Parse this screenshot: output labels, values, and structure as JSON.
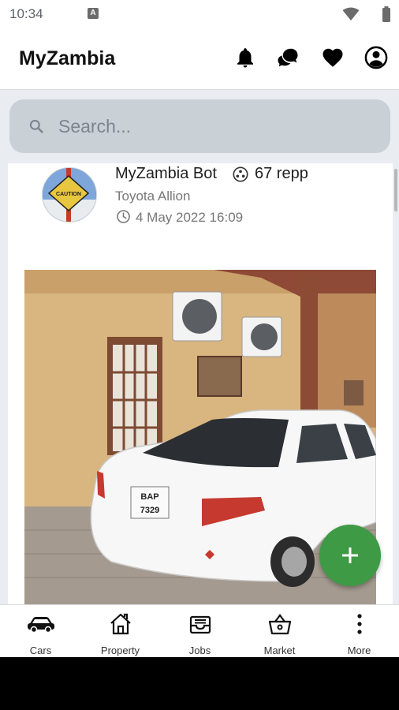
{
  "status_bar": {
    "time": "10:34",
    "notification_icon": "A"
  },
  "app_bar": {
    "title": "MyZambia",
    "icons": [
      "bell-icon",
      "chat-icon",
      "heart-icon",
      "account-icon"
    ]
  },
  "search": {
    "placeholder": "Search..."
  },
  "post": {
    "author": "MyZambia Bot",
    "reputation": "67 repp",
    "subtitle": "Toyota Allion",
    "date": "4 May 2022 16:09",
    "image_alt": "White Toyota Allion parked outside a building",
    "plate": [
      "BAP",
      "7329"
    ],
    "caution_sign": "CAUTION"
  },
  "fab": {
    "icon": "plus-icon",
    "color": "#3e9a45"
  },
  "bottom_nav": {
    "items": [
      {
        "label": "Cars",
        "icon": "car-icon"
      },
      {
        "label": "Property",
        "icon": "house-icon"
      },
      {
        "label": "Jobs",
        "icon": "inbox-icon"
      },
      {
        "label": "Market",
        "icon": "basket-icon"
      },
      {
        "label": "More",
        "icon": "more-vert-icon"
      }
    ]
  }
}
